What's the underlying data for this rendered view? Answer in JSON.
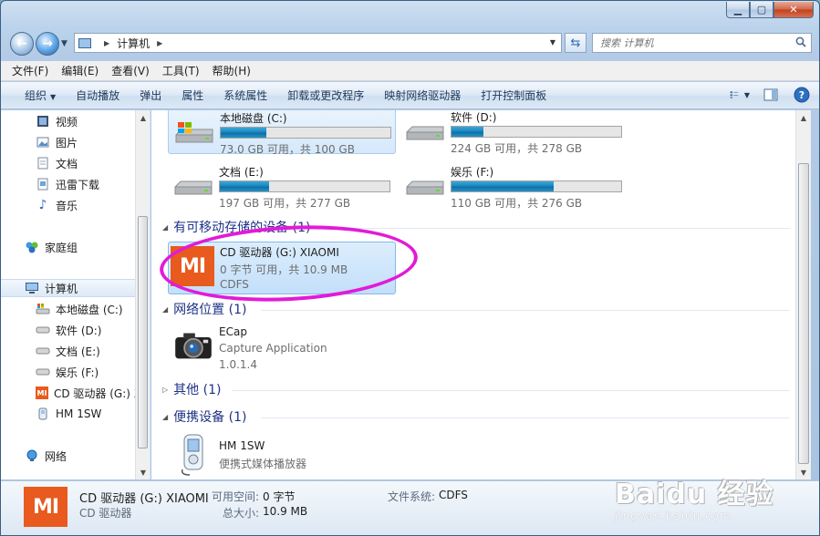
{
  "address": {
    "crumb": "计算机"
  },
  "search": {
    "placeholder": "搜索 计算机"
  },
  "menu": [
    "文件(F)",
    "编辑(E)",
    "查看(V)",
    "工具(T)",
    "帮助(H)"
  ],
  "commands": [
    "组织",
    "自动播放",
    "弹出",
    "属性",
    "系统属性",
    "卸载或更改程序",
    "映射网络驱动器",
    "打开控制面板"
  ],
  "nav": {
    "favorites": [
      "视频",
      "图片",
      "文档",
      "迅雷下载",
      "音乐"
    ],
    "homegroup": "家庭组",
    "computer": "计算机",
    "computer_children": [
      "本地磁盘 (C:)",
      "软件 (D:)",
      "文档 (E:)",
      "娱乐 (F:)",
      "CD 驱动器 (G:) X",
      "HM 1SW"
    ],
    "network": "网络"
  },
  "drives": [
    {
      "name": "本地磁盘 (C:)",
      "space": "73.0 GB 可用，共 100 GB",
      "used_fraction": 0.27
    },
    {
      "name": "软件 (D:)",
      "space": "224 GB 可用，共 278 GB",
      "used_fraction": 0.19
    },
    {
      "name": "文档 (E:)",
      "space": "197 GB 可用，共 277 GB",
      "used_fraction": 0.29
    },
    {
      "name": "娱乐 (F:)",
      "space": "110 GB 可用，共 276 GB",
      "used_fraction": 0.6
    }
  ],
  "groups": {
    "removable": "有可移动存储的设备 (1)",
    "network": "网络位置 (1)",
    "other": "其他 (1)",
    "portable": "便携设备 (1)"
  },
  "cd_drive": {
    "name": "CD 驱动器 (G:) XIAOMI",
    "space": "0 字节 可用，共 10.9 MB",
    "fs": "CDFS",
    "logo": "MI"
  },
  "ecap": {
    "name": "ECap",
    "desc": "Capture Application",
    "version": "1.0.1.4"
  },
  "hm": {
    "name": "HM 1SW",
    "desc": "便携式媒体播放器"
  },
  "details": {
    "title": "CD 驱动器 (G:) XIAOMI",
    "type": "CD 驱动器",
    "free_label": "可用空间:",
    "free_value": "0 字节",
    "total_label": "总大小:",
    "total_value": "10.9 MB",
    "fs_label": "文件系统:",
    "fs_value": "CDFS"
  },
  "watermark": {
    "logo": "Baidu 经验",
    "url": "jingyan.baidu.com"
  },
  "colors": {
    "accent_magenta": "#e21ad8",
    "xiaomi_orange": "#e85a1e",
    "drive_bar": "#1a87c0"
  }
}
